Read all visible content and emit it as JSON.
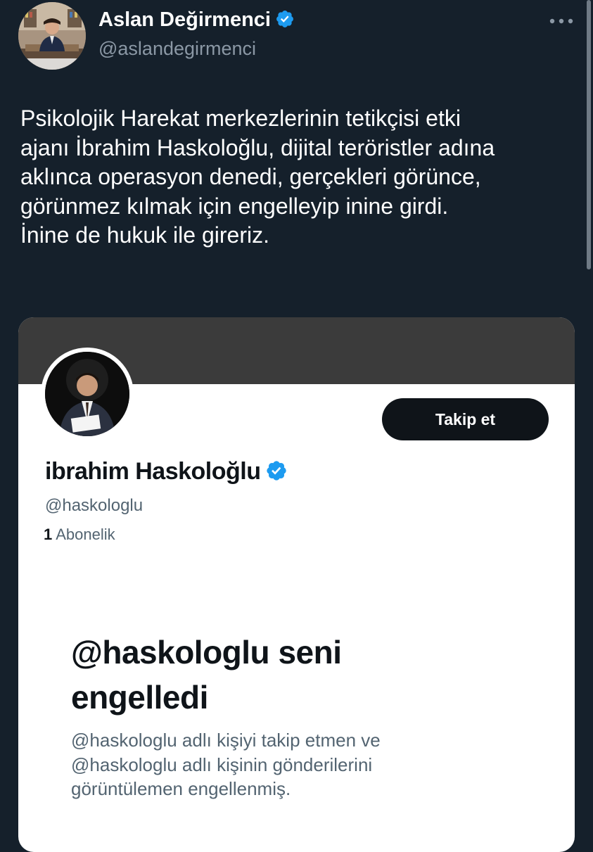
{
  "author": {
    "name": "Aslan Değirmenci",
    "handle": "@aslandegirmenci",
    "verified": true,
    "avatar_icon": "profile-photo"
  },
  "more_icon": "ellipsis-icon",
  "tweet": {
    "lines": [
      "Psikolojik Harekat merkezlerinin tetikçisi etki",
      "ajanı İbrahim Haskoloğlu, dijital teröristler adına",
      "aklınca operasyon denedi, gerçekleri görünce,",
      "görünmez kılmak için engelleyip inine girdi.",
      "İnine de hukuk ile gireriz."
    ]
  },
  "embedded_profile": {
    "name": "ibrahim Haskoloğlu",
    "handle": "@haskologlu",
    "verified": true,
    "follow_button": "Takip et",
    "stats_count": "1",
    "stats_label": "Abonelik",
    "blocked_title_lines": [
      "@haskologlu seni",
      "engelledi"
    ],
    "blocked_desc_lines": [
      "@haskologlu adlı kişiyi takip etmen ve",
      "@haskologlu adlı kişinin gönderilerini",
      "görüntülemen engellenmiş."
    ]
  },
  "colors": {
    "background": "#15202b",
    "verified_blue": "#1d9bf0",
    "secondary_text": "#8b98a5",
    "card_dark_button": "#0f1419"
  }
}
